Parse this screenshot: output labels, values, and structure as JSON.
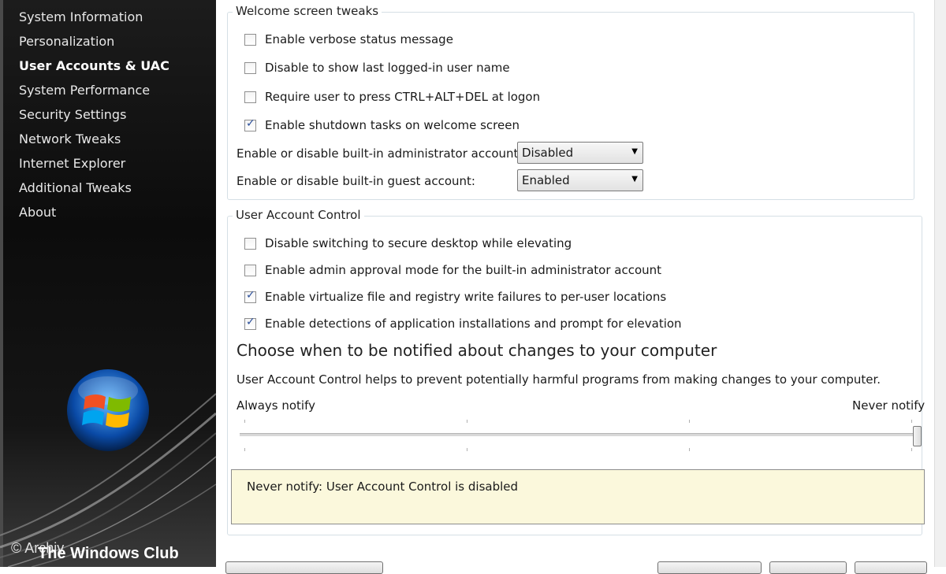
{
  "sidebar": {
    "items": [
      {
        "label": "System Information"
      },
      {
        "label": "Personalization"
      },
      {
        "label": "User Accounts & UAC",
        "active": true
      },
      {
        "label": "System Performance"
      },
      {
        "label": "Security Settings"
      },
      {
        "label": "Network Tweaks"
      },
      {
        "label": "Internet Explorer"
      },
      {
        "label": "Additional Tweaks"
      },
      {
        "label": "About"
      }
    ],
    "brand": "The Windows Club",
    "watermark": "© Archiv"
  },
  "welcome": {
    "legend": "Welcome screen tweaks",
    "options": [
      {
        "label": "Enable verbose status message",
        "checked": false
      },
      {
        "label": "Disable to show last logged-in user name",
        "checked": false
      },
      {
        "label": "Require user to press CTRL+ALT+DEL at logon",
        "checked": false
      },
      {
        "label": "Enable shutdown tasks on welcome screen",
        "checked": true
      }
    ],
    "admin_label": "Enable or disable built-in administrator account:",
    "admin_value": "Disabled",
    "guest_label": "Enable or disable built-in guest account:",
    "guest_value": "Enabled"
  },
  "uac": {
    "legend": "User Account Control",
    "options": [
      {
        "label": "Disable switching to secure desktop while elevating",
        "checked": false
      },
      {
        "label": "Enable admin approval mode for the built-in administrator account",
        "checked": false
      },
      {
        "label": "Enable virtualize file and registry write failures to per-user locations",
        "checked": true
      },
      {
        "label": "Enable detections of application installations and prompt for elevation",
        "checked": true
      }
    ],
    "heading": "Choose when to be notified about changes to your computer",
    "description": "User Account Control helps to prevent potentially harmful programs from making changes to your computer.",
    "slider_left_label": "Always notify",
    "slider_right_label": "Never notify",
    "slider_level": 1.0,
    "notice": "Never notify: User Account Control is disabled"
  },
  "colors": {
    "notice_bg": "#fbf8dc",
    "check_color": "#2b4f9b"
  }
}
